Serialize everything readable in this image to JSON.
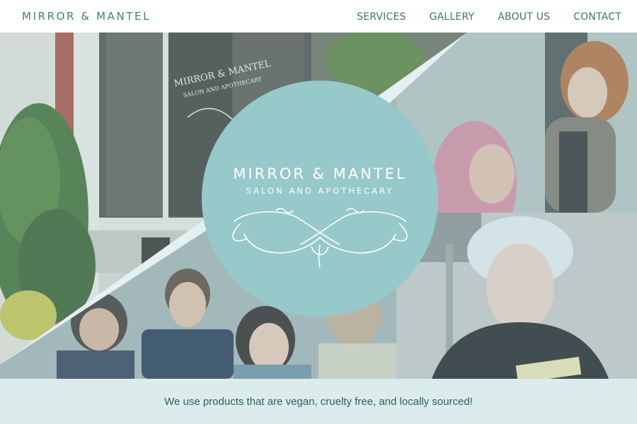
{
  "header": {
    "logo_text": "MIRROR & MANTEL",
    "nav": {
      "services": "SERVICES",
      "gallery": "GALLERY",
      "about": "ABOUT US",
      "contact": "CONTACT"
    }
  },
  "window_sign": {
    "line1": "MIRROR & MANTEL",
    "line2": "SALON AND APOTHECARY"
  },
  "badge": {
    "title": "MIRROR & MANTEL",
    "subtitle": "SALON AND APOTHECARY"
  },
  "banner": {
    "text": "We use products that are vegan, cruelty free, and locally sourced!"
  },
  "colors": {
    "accent": "#3f7e7d",
    "badge": "#97c8ca",
    "banner_bg": "#dcecec",
    "banner_text": "#2e5f63"
  }
}
